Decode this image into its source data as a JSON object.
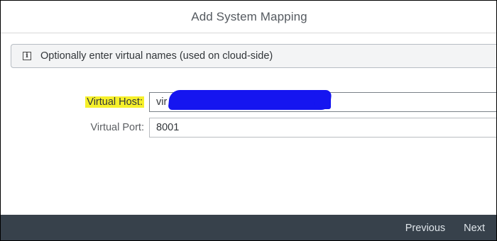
{
  "dialog": {
    "title": "Add System Mapping"
  },
  "info_bar": {
    "icon": "info-icon",
    "icon_glyph": "i",
    "message": "Optionally enter virtual names (used on cloud-side)"
  },
  "form": {
    "virtual_host": {
      "label": "Virtual Host:",
      "value": "vir",
      "highlighted": true,
      "redacted": true
    },
    "virtual_port": {
      "label": "Virtual Port:",
      "value": "8001"
    }
  },
  "footer": {
    "previous_label": "Previous",
    "next_label": "Next"
  },
  "colors": {
    "footer_background": "#37414b",
    "label_highlight": "#f6f02a",
    "redaction": "#1515f0"
  }
}
